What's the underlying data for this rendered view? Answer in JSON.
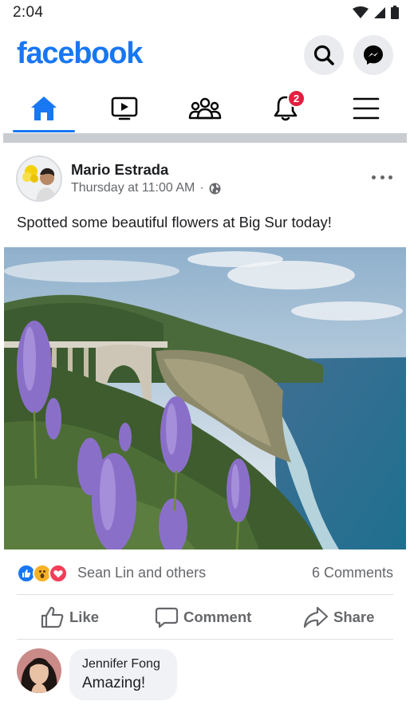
{
  "status_bar": {
    "time": "2:04",
    "icons": [
      "wifi-icon",
      "signal-icon",
      "battery-icon"
    ]
  },
  "header": {
    "logo": "facebook",
    "buttons": [
      "search-icon",
      "messenger-icon"
    ]
  },
  "tabs": [
    {
      "name": "home",
      "icon": "home-icon",
      "active": true
    },
    {
      "name": "watch",
      "icon": "video-icon"
    },
    {
      "name": "groups",
      "icon": "groups-icon"
    },
    {
      "name": "notifications",
      "icon": "bell-icon",
      "badge": "2"
    },
    {
      "name": "menu",
      "icon": "hamburger-menu-icon"
    }
  ],
  "post": {
    "author": "Mario Estrada",
    "timestamp": "Thursday at 11:00 AM",
    "separator": "·",
    "audience_icon": "globe-icon",
    "text": "Spotted some beautiful flowers at Big Sur today!",
    "reactions": [
      "like",
      "wow",
      "love"
    ],
    "reaction_names": "Sean Lin and others",
    "comment_count": "6 Comments"
  },
  "actions": {
    "like": "Like",
    "comment": "Comment",
    "share": "Share"
  },
  "comment": {
    "name": "Jennifer Fong",
    "text": "Amazing!"
  },
  "colors": {
    "brand": "#1877f2",
    "badge": "#e41e3f",
    "secondary_text": "#65676b",
    "divider": "#c9ccd1"
  }
}
